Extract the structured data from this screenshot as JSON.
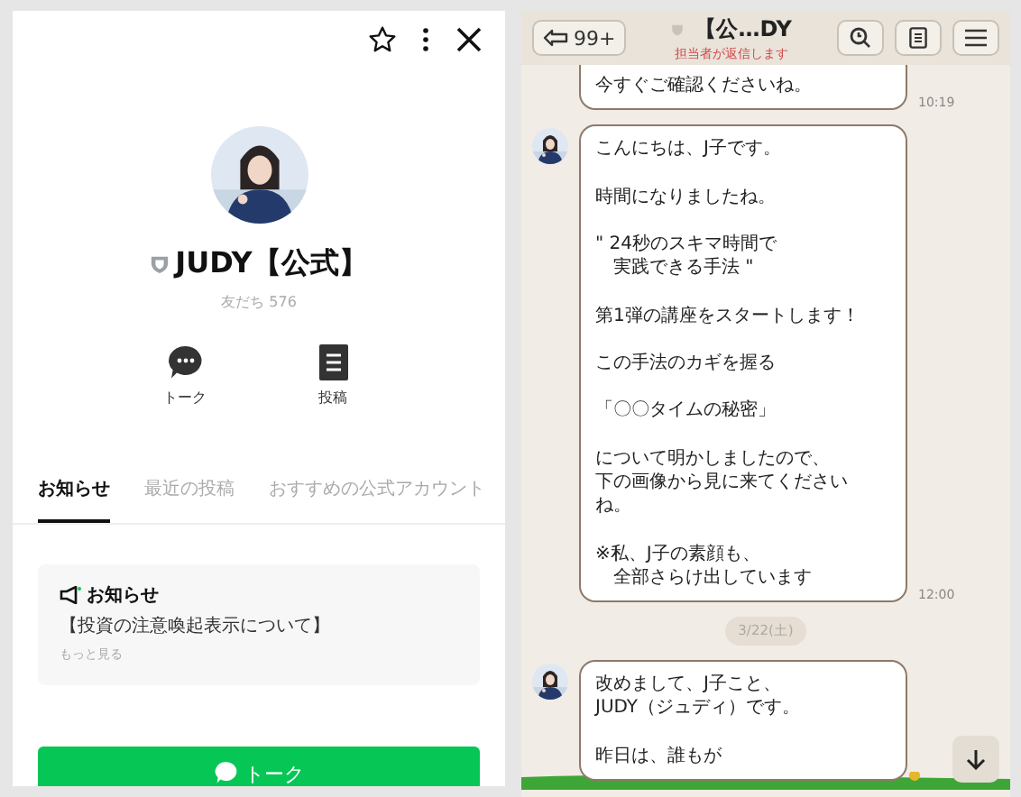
{
  "profile": {
    "name": "JUDY【公式】",
    "friends": "友だち 576",
    "actions": [
      {
        "kind": "talk",
        "label": "トーク"
      },
      {
        "kind": "posts",
        "label": "投稿"
      }
    ],
    "tabs": [
      {
        "label": "お知らせ",
        "selected": true
      },
      {
        "label": "最近の投稿",
        "selected": false
      },
      {
        "label": "おすすめの公式アカウント",
        "selected": false
      }
    ],
    "notice": {
      "title": "お知らせ",
      "text": "【投資の注意喚起表示について】",
      "more": "もっと見る"
    },
    "talk_button": "トーク"
  },
  "chat": {
    "back_count": "99+",
    "title": "【公…DY",
    "subtitle": "担当者が返信します",
    "messages": [
      {
        "kind": "message",
        "avatar": false,
        "paragraphs": [
          [
            "今すぐご確認くださいね。"
          ]
        ],
        "time": "10:19"
      },
      {
        "kind": "message",
        "avatar": true,
        "paragraphs": [
          [
            "こんにちは、J子です。"
          ],
          [
            "時間になりましたね。"
          ],
          [
            "\" 24秒のスキマ時間で",
            "　実践できる手法 \""
          ],
          [
            "第1弾の講座をスタートします！"
          ],
          [
            "この手法のカギを握る"
          ],
          [
            "「〇〇タイムの秘密」"
          ],
          [
            "について明かしましたので、",
            "下の画像から見に来てください",
            "ね。"
          ],
          [
            "※私、J子の素顔も、",
            "　全部さらけ出しています"
          ]
        ],
        "time": "12:00"
      },
      {
        "kind": "date",
        "text": "3/22(土)"
      },
      {
        "kind": "message",
        "avatar": true,
        "paragraphs": [
          [
            "改めまして、J子こと、",
            "JUDY（ジュディ）です。"
          ],
          [
            "昨日は、誰もが"
          ]
        ]
      }
    ]
  }
}
